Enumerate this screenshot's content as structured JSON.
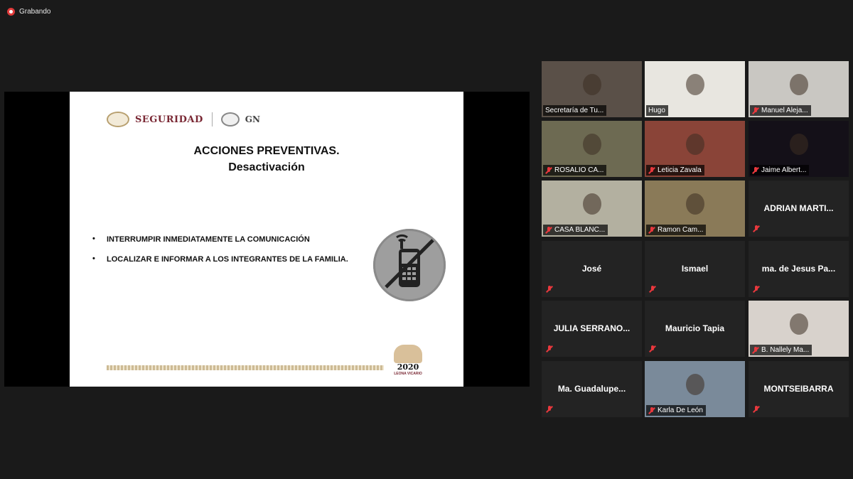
{
  "recording": {
    "label": "Grabando"
  },
  "slide": {
    "logo_text": "SEGURIDAD",
    "logo_gn": "GN",
    "title": "ACCIONES PREVENTIVAS.",
    "subtitle": "Desactivación",
    "bullets": [
      "INTERRUMPIR INMEDIATAMENTE LA COMUNICACIÓN",
      "LOCALIZAR E INFORMAR A LOS INTEGRANTES DE LA FAMILIA."
    ],
    "footer_year": "2020",
    "footer_name": "LEONA VICARIO",
    "icon": "no-phone-icon"
  },
  "participants": [
    {
      "name": "Secretaría de Tu...",
      "video": true,
      "muted": false,
      "active": false,
      "bg": "#5a5048"
    },
    {
      "name": "Hugo",
      "video": true,
      "muted": false,
      "active": true,
      "bg": "#e8e6e0"
    },
    {
      "name": "Manuel Aleja...",
      "video": true,
      "muted": true,
      "active": false,
      "bg": "#c9c7c2"
    },
    {
      "name": "ROSALIO CA...",
      "video": true,
      "muted": true,
      "active": false,
      "bg": "#6d6a52"
    },
    {
      "name": "Leticia Zavala",
      "video": true,
      "muted": true,
      "active": false,
      "bg": "#8a4438"
    },
    {
      "name": "Jaime Albert...",
      "video": true,
      "muted": true,
      "active": false,
      "bg": "#141018"
    },
    {
      "name": "CASA BLANC...",
      "video": true,
      "muted": true,
      "active": false,
      "bg": "#b3b0a0"
    },
    {
      "name": "Ramon Cam...",
      "video": true,
      "muted": true,
      "active": false,
      "bg": "#8a7a58"
    },
    {
      "name": "ADRIAN MARTI...",
      "video": false,
      "muted": true,
      "active": false
    },
    {
      "name": "José",
      "video": false,
      "muted": true,
      "active": false
    },
    {
      "name": "Ismael",
      "video": false,
      "muted": true,
      "active": false
    },
    {
      "name": "ma. de Jesus Pa...",
      "video": false,
      "muted": true,
      "active": false
    },
    {
      "name": "JULIA SERRANO...",
      "video": false,
      "muted": true,
      "active": false
    },
    {
      "name": "Mauricio Tapia",
      "video": false,
      "muted": true,
      "active": false
    },
    {
      "name": "B. Nallely Ma...",
      "video": true,
      "muted": true,
      "active": false,
      "bg": "#d8d2cc"
    },
    {
      "name": "Ma. Guadalupe...",
      "video": false,
      "muted": true,
      "active": false
    },
    {
      "name": "Karla De León",
      "video": true,
      "muted": true,
      "active": false,
      "bg": "#7a8a9a"
    },
    {
      "name": "MONTSEIBARRA",
      "video": false,
      "muted": true,
      "active": false
    }
  ]
}
